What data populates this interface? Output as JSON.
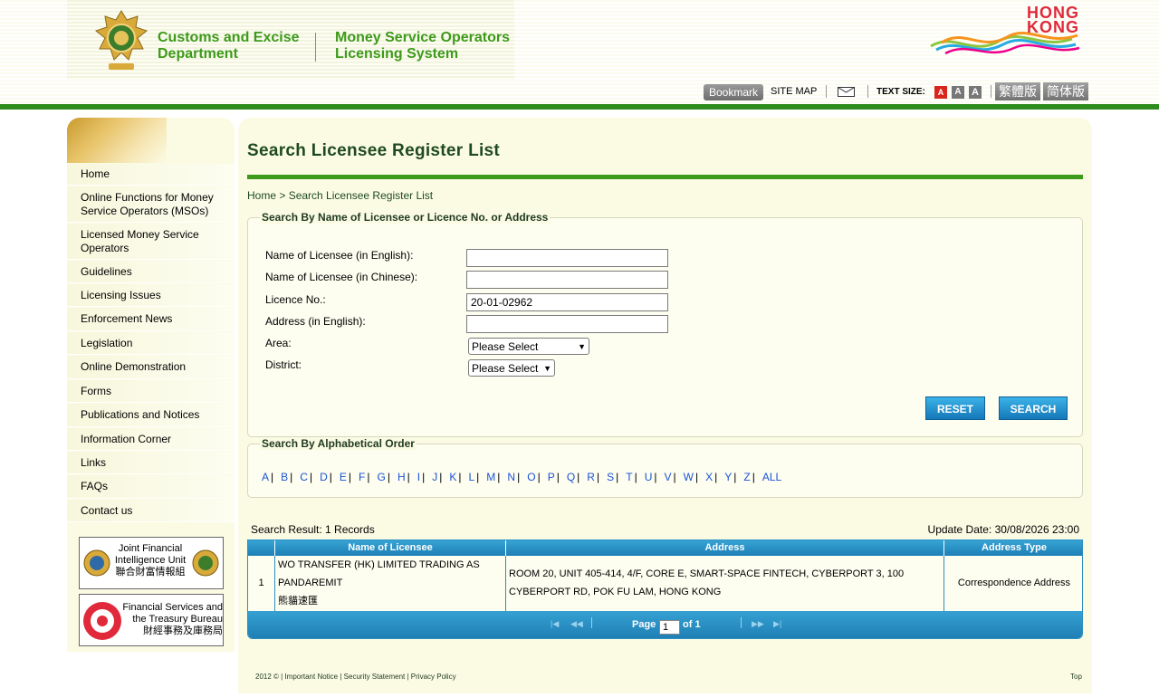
{
  "header": {
    "department_line1": "Customs and Excise",
    "department_line2": "Department",
    "system_line1": "Money Service Operators",
    "system_line2": "Licensing System",
    "hk_logo_line1": "HONG",
    "hk_logo_line2": "KONG",
    "bookmark_label": "Bookmark",
    "sitemap_label": "SITE MAP",
    "text_size_label": "TEXT SIZE:",
    "text_size_buttons": [
      "A",
      "A",
      "A"
    ],
    "lang_trad": "繁體版",
    "lang_simp": "简体版",
    "colors": {
      "brand_green": "#2e8b1d",
      "title_green": "#3d9a1a",
      "accent_blue": "#1d7fb5"
    }
  },
  "sidebar": {
    "items": [
      "Home",
      "Online Functions for Money Service Operators (MSOs)",
      "Licensed Money Service Operators",
      "Guidelines",
      "Licensing Issues",
      "Enforcement News",
      "Legislation",
      "Online Demonstration",
      "Forms",
      "Publications and Notices",
      "Information Corner",
      "Links",
      "FAQs",
      "Contact us"
    ],
    "jfiu": {
      "line1": "Joint Financial",
      "line2": "Intelligence Unit",
      "line3": "聯合財富情報組"
    },
    "fstb": {
      "line1": "Financial Services and",
      "line2": "the Treasury Bureau",
      "line3": "財經事務及庫務局"
    }
  },
  "main": {
    "title": "Search Licensee Register List",
    "breadcrumb_home": "Home",
    "breadcrumb_sep": " > ",
    "breadcrumb_current": "Search Licensee Register List",
    "search_by_name_legend": "Search By Name of Licensee or Licence No. or Address",
    "fields": {
      "name_en_label": "Name of Licensee (in English):",
      "name_en_value": "",
      "name_zh_label": "Name of Licensee (in Chinese):",
      "name_zh_value": "",
      "licence_label": "Licence No.:",
      "licence_value": "20-01-02962",
      "address_label": "Address (in English):",
      "address_value": "",
      "area_label": "Area:",
      "area_selected": "Please Select",
      "district_label": "District:",
      "district_selected": "Please Select"
    },
    "reset_label": "RESET",
    "search_label": "SEARCH",
    "alpha_legend": "Search By Alphabetical Order",
    "alpha_letters": [
      "A",
      "B",
      "C",
      "D",
      "E",
      "F",
      "G",
      "H",
      "I",
      "J",
      "K",
      "L",
      "M",
      "N",
      "O",
      "P",
      "Q",
      "R",
      "S",
      "T",
      "U",
      "V",
      "W",
      "X",
      "Y",
      "Z",
      "ALL"
    ],
    "result_count": "Search Result: 1 Records",
    "update_date": "Update Date: 30/08/2026 23:00",
    "table": {
      "headers": [
        "",
        "Name of Licensee",
        "Address",
        "Address Type"
      ],
      "rows": [
        {
          "index": "1",
          "name_line1": "WO TRANSFER (HK) LIMITED TRADING AS",
          "name_line2": "PANDAREMIT",
          "name_line3": "熊貓速匯",
          "address_line1": "ROOM 20, UNIT 405-414, 4/F, CORE E, SMART-SPACE FINTECH, CYBERPORT 3, 100",
          "address_line2": "CYBERPORT RD, POK FU LAM, HONG KONG",
          "address_type": "Correspondence Address"
        }
      ],
      "pager": {
        "page_label": "Page",
        "page_value": "1",
        "of_label": "of 1"
      }
    }
  },
  "footer": {
    "copyright": "2012 © | ",
    "important_notice": "Important Notice",
    "security": "Security Statement",
    "privacy": "Privacy Policy",
    "sep": " | ",
    "top": "Top"
  }
}
